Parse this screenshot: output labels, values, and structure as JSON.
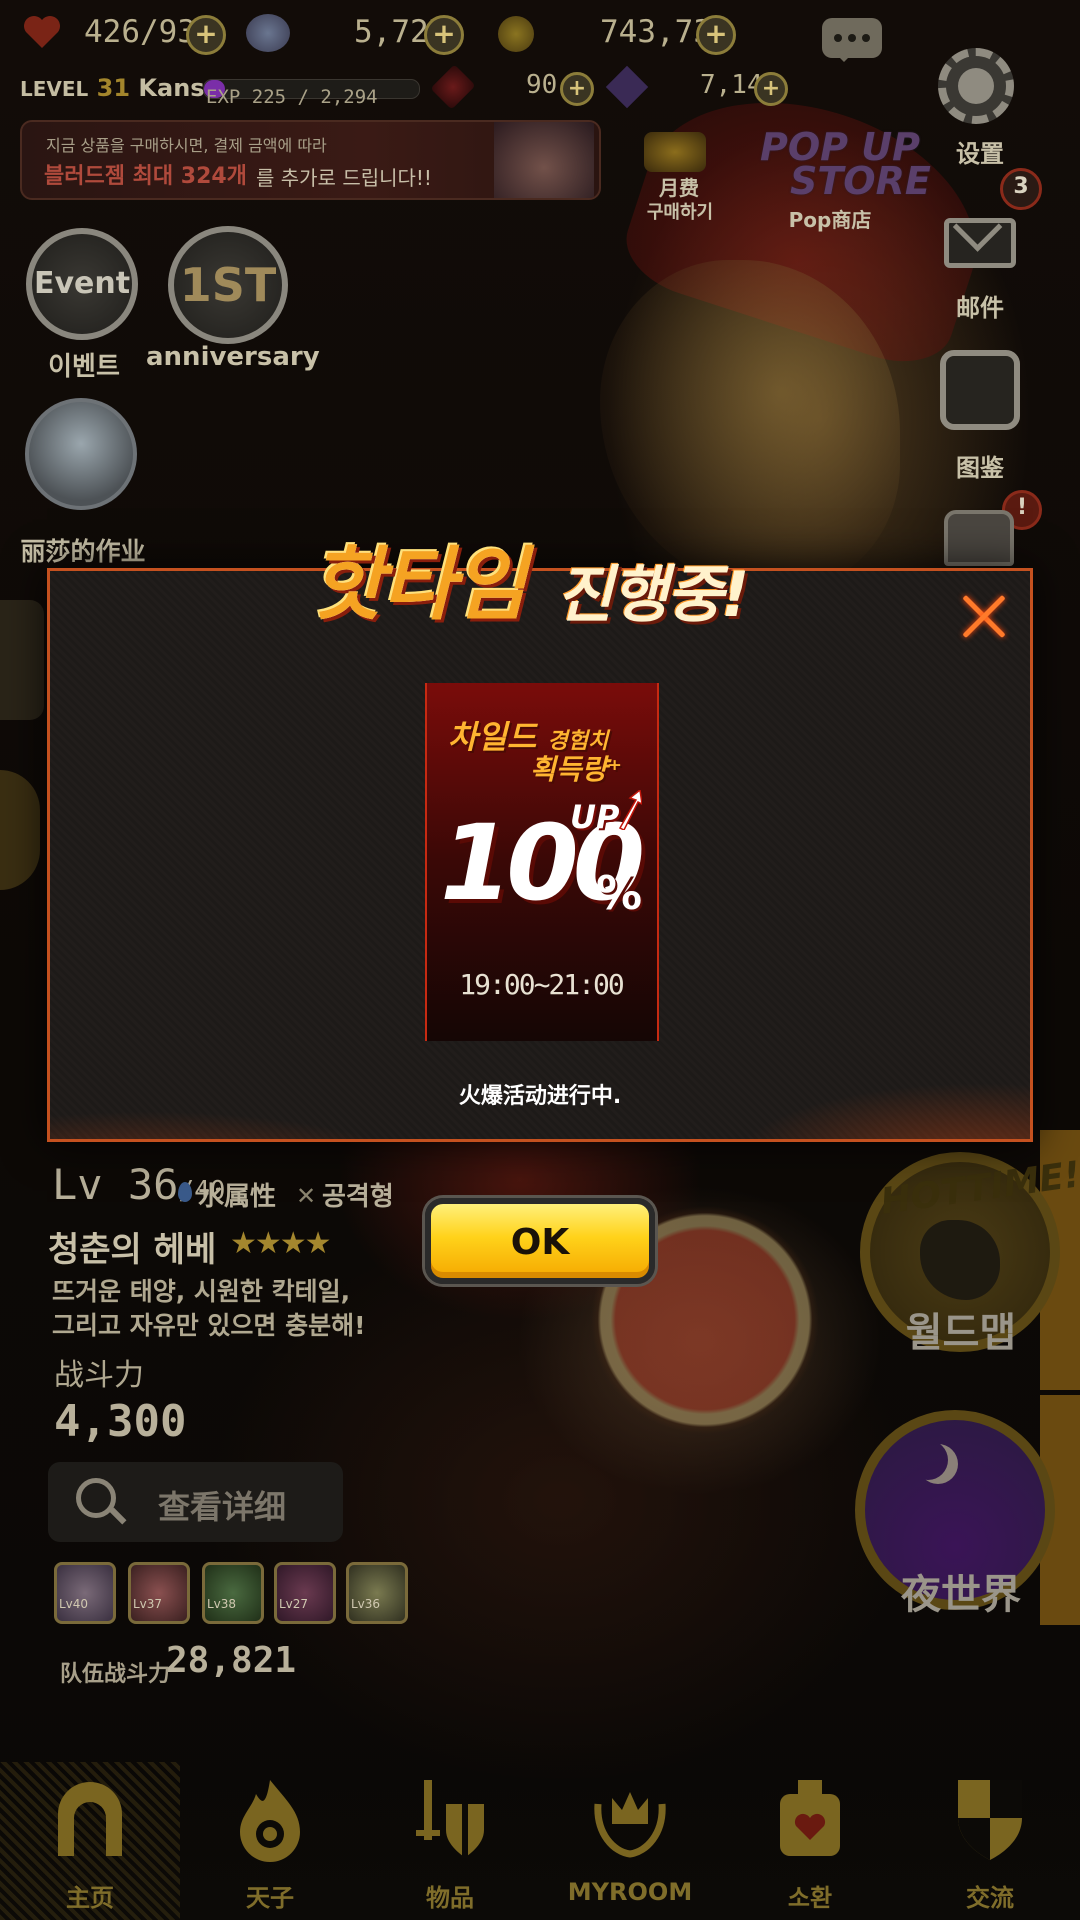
{
  "hud": {
    "stamina": "426",
    "stamina_max": "/93",
    "gems": "5,727",
    "gold": "743,735",
    "level_label": "LEVEL",
    "level": "31",
    "username": "Kansan",
    "exp_text": "EXP 225 / 2,294",
    "exp_fraction": 0.098,
    "blood_gems": "90",
    "crystals": "7,149"
  },
  "banner": {
    "line1": "지금 상품을 구매하시면, 결제 금액에 따라",
    "line2_highlight": "블러드젬 최대 324개",
    "line2_rest": "를 추가로 드립니다!!"
  },
  "top_right": {
    "monthly_line1": "月费",
    "monthly_line2": "구매하기",
    "popup_logo_l1": "POP UP",
    "popup_logo_l2": "STORE",
    "popup_store_label": "Pop商店",
    "settings_label": "设置",
    "mail_badge": "3",
    "mail_label": "邮件",
    "dex_label": "图鉴",
    "chest_badge": "!"
  },
  "left_icons": {
    "event_inner": "Event",
    "event_label": "이벤트",
    "anniv_inner": "1ST",
    "anniv_label": "anniversary",
    "homework_label": "丽莎的作业"
  },
  "popup": {
    "title_part1": "핫타임",
    "title_part2": "진행중!",
    "card_line1": "차일드",
    "card_line1_small": "경험치",
    "card_line2": "획득량⁺",
    "card_up": "UP",
    "card_value": "100",
    "card_unit": "%",
    "card_time": "19:00~21:00",
    "message": "火爆活动进行中.",
    "ok_label": "OK"
  },
  "hero": {
    "lv": "Lv 36",
    "lv_max": "/40",
    "element": "水属性",
    "role": "공격형",
    "name": "청춘의 헤베",
    "stars": "★★★★",
    "star_count": 4,
    "desc1": "뜨거운 태양, 시원한 칵테일,",
    "desc2": "그리고 자유만 있으면 충분해!",
    "power_label": "战斗力",
    "power_value": "4,300",
    "detail_button": "查看详细",
    "team": [
      {
        "lv": "Lv40"
      },
      {
        "lv": "Lv37"
      },
      {
        "lv": "Lv38"
      },
      {
        "lv": "Lv27"
      },
      {
        "lv": "Lv36"
      }
    ],
    "team_power_label": "队伍战斗力",
    "team_power_value": "28,821"
  },
  "right_buttons": {
    "hottime_badge": "HOTTIME!",
    "world_map": "월드맵",
    "night_world": "夜世界"
  },
  "nav": {
    "items": [
      {
        "label": "主页",
        "icon": "home-arch-icon"
      },
      {
        "label": "天子",
        "icon": "flame-eye-icon"
      },
      {
        "label": "物品",
        "icon": "sword-shield-icon"
      },
      {
        "label": "MYROOM",
        "icon": "crown-laurel-icon"
      },
      {
        "label": "소환",
        "icon": "heart-bottle-icon"
      },
      {
        "label": "交流",
        "icon": "shield-icon"
      }
    ]
  },
  "colors": {
    "accent_gold": "#ffd21a",
    "popup_border": "#c5511f",
    "hot_orange": "#f5a322"
  }
}
